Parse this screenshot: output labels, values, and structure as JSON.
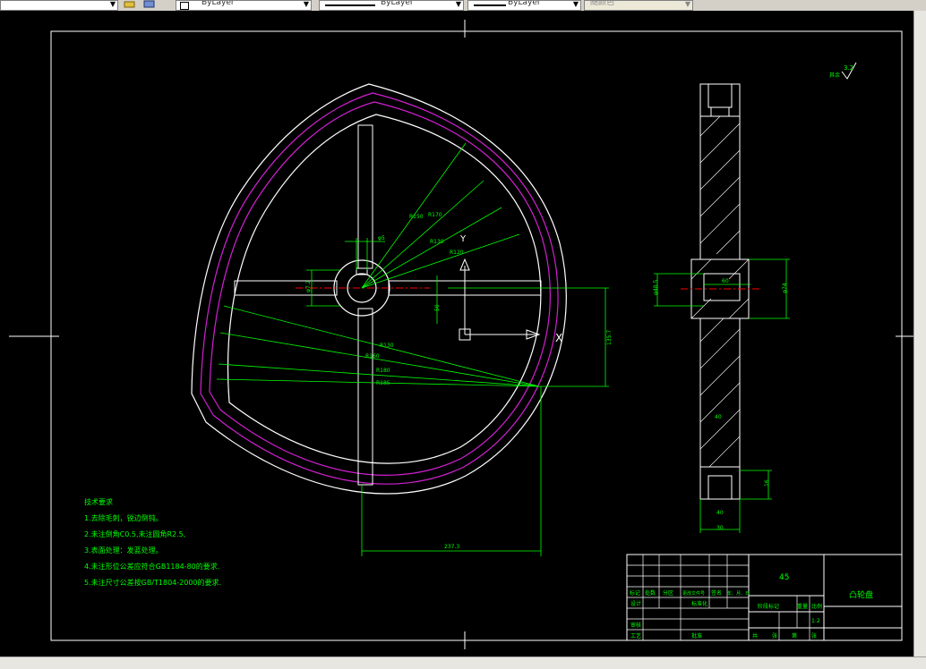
{
  "toolbar": {
    "layer_icon": "layer-icon",
    "color_combo": "ByLayer",
    "linetype_combo": "ByLayer",
    "lineweight_combo": "ByLayer",
    "plotstyle_combo": "随颜色"
  },
  "drawing": {
    "surface_finish": "3.2",
    "surface_finish_note": "其余",
    "tech_title": "技术要求",
    "tech_items": [
      "1.去除毛刺，锐边倒钝。",
      "2.未注倒角C0.5,未注圆角R2.5,",
      "3.表面处理：发蓝处理。",
      "4.未注形位公差应符合GB1184-80的要求.",
      "5.未注尺寸公差按GB/T1804-2000的要求."
    ],
    "dims": {
      "radii": [
        "R150",
        "R170",
        "R130",
        "R120"
      ],
      "radii_lower": [
        "R130",
        "R160",
        "R180",
        "R185"
      ],
      "bore_dia": "φ5",
      "hub_dia": "φ7.2",
      "offset": "50",
      "height": "135.7",
      "width": "237.3",
      "side_bore": "φ40",
      "side_hub": "φ48.5",
      "side_hub_w": "φ74",
      "rim_w": "40",
      "rim_groove": "20",
      "side_hub_len": "60",
      "side_bottom": "40",
      "side_bottom2": "30",
      "side_small": "16",
      "key": "5",
      "mid": "40"
    },
    "title_block": {
      "material": "45",
      "part_name": "凸轮盘",
      "scale": "1:2",
      "labels_row1": [
        "标记",
        "处数",
        "分区",
        "更改文件号",
        "签名",
        "年、月、日"
      ],
      "row_design": "设计",
      "row_std": "标准化",
      "row_check": "审核",
      "row_process": "工艺",
      "row_approve": "批准",
      "stage_mark": "阶段标记",
      "weight": "重量",
      "ratio": "比例",
      "sheets": [
        "共",
        "张",
        "第",
        "张"
      ]
    }
  }
}
